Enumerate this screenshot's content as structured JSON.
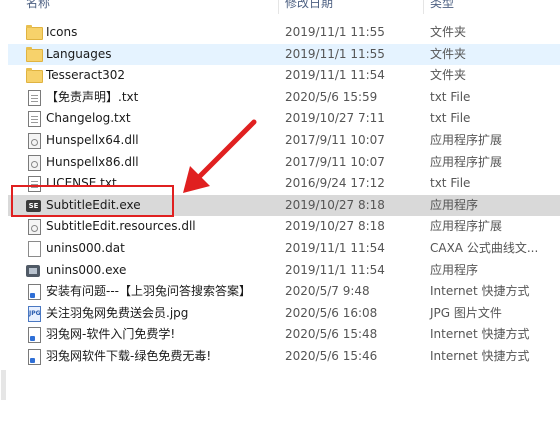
{
  "header": {
    "col_name": "名称",
    "col_date": "修改日期",
    "col_type": "类型"
  },
  "files": [
    {
      "name": "Icons",
      "date": "2019/11/1 11:55",
      "type": "文件夹",
      "icon": "folder-icon",
      "state": "normal"
    },
    {
      "name": "Languages",
      "date": "2019/11/1 11:55",
      "type": "文件夹",
      "icon": "folder-icon",
      "state": "hover"
    },
    {
      "name": "Tesseract302",
      "date": "2019/11/1 11:54",
      "type": "文件夹",
      "icon": "folder-icon",
      "state": "normal"
    },
    {
      "name": "【免责声明】.txt",
      "date": "2020/5/6 15:59",
      "type": "txt File",
      "icon": "text-file-icon",
      "state": "normal"
    },
    {
      "name": "Changelog.txt",
      "date": "2019/10/27 7:11",
      "type": "txt File",
      "icon": "text-file-icon",
      "state": "normal"
    },
    {
      "name": "Hunspellx64.dll",
      "date": "2017/9/11 10:07",
      "type": "应用程序扩展",
      "icon": "dll-file-icon",
      "state": "normal"
    },
    {
      "name": "Hunspellx86.dll",
      "date": "2017/9/11 10:07",
      "type": "应用程序扩展",
      "icon": "dll-file-icon",
      "state": "normal"
    },
    {
      "name": "LICENSE.txt",
      "date": "2016/9/24 17:12",
      "type": "txt File",
      "icon": "text-file-icon",
      "state": "normal"
    },
    {
      "name": "SubtitleEdit.exe",
      "date": "2019/10/27 8:18",
      "type": "应用程序",
      "icon": "subtitle-edit-exe-icon",
      "state": "selected"
    },
    {
      "name": "SubtitleEdit.resources.dll",
      "date": "2019/10/27 8:18",
      "type": "应用程序扩展",
      "icon": "dll-file-icon",
      "state": "normal"
    },
    {
      "name": "unins000.dat",
      "date": "2019/11/1 11:54",
      "type": "CAXA 公式曲线文...",
      "icon": "dat-file-icon",
      "state": "normal"
    },
    {
      "name": "unins000.exe",
      "date": "2019/11/1 11:54",
      "type": "应用程序",
      "icon": "uninstaller-exe-icon",
      "state": "normal"
    },
    {
      "name": "安装有问题---【上羽兔问答搜索答案】",
      "date": "2020/5/7 9:48",
      "type": "Internet 快捷方式",
      "icon": "internet-shortcut-icon",
      "state": "normal"
    },
    {
      "name": "关注羽兔网免费送会员.jpg",
      "date": "2020/5/6 16:08",
      "type": "JPG 图片文件",
      "icon": "jpg-file-icon",
      "state": "normal"
    },
    {
      "name": "羽兔网-软件入门免费学!",
      "date": "2020/5/6 15:48",
      "type": "Internet 快捷方式",
      "icon": "internet-shortcut-icon",
      "state": "normal"
    },
    {
      "name": "羽兔网软件下载-绿色免费无毒!",
      "date": "2020/5/6 15:46",
      "type": "Internet 快捷方式",
      "icon": "internet-shortcut-icon",
      "state": "normal"
    }
  ],
  "icon_text": {
    "exe": "SE",
    "jpg": "JPG"
  },
  "colors": {
    "annotation": "#e02020",
    "hover": "#e5f3ff",
    "selected": "#d9d9d9"
  }
}
